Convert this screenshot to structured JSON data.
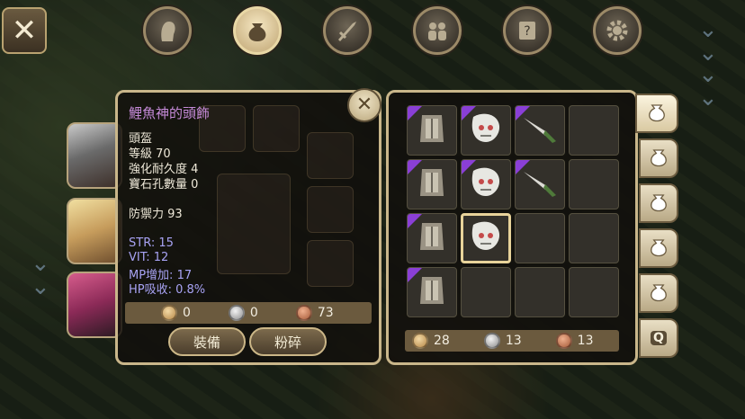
{
  "top_menu": [
    {
      "icon": "profile-icon",
      "active": false
    },
    {
      "icon": "bag-icon",
      "active": true
    },
    {
      "icon": "sword-icon",
      "active": false
    },
    {
      "icon": "party-icon",
      "active": false
    },
    {
      "icon": "quest-scroll-icon",
      "active": false
    },
    {
      "icon": "settings-icon",
      "active": false
    }
  ],
  "item": {
    "name": "鯉魚神的頭飾",
    "type": "頭盔",
    "level": "等級 70",
    "durability": "強化耐久度 4",
    "gem_slots": "寶石孔數量 0",
    "defense": "防禦力 93",
    "stats": [
      "STR: 15",
      "VIT: 12",
      "MP增加: 17",
      "HP吸收: 0.8%"
    ],
    "price": {
      "gold": "0",
      "silver": "0",
      "copper": "73"
    },
    "equip_label": "裝備",
    "crush_label": "粉碎"
  },
  "inventory": {
    "slots": [
      {
        "item": "armor-icon",
        "rare": true
      },
      {
        "item": "mask-icon",
        "rare": true
      },
      {
        "item": "knife-icon",
        "rare": true
      },
      {
        "item": null,
        "rare": false
      },
      {
        "item": "armor-icon",
        "rare": true
      },
      {
        "item": "mask-icon",
        "rare": true
      },
      {
        "item": "knife-icon",
        "rare": true
      },
      {
        "item": null,
        "rare": false
      },
      {
        "item": "armor-icon",
        "rare": true
      },
      {
        "item": "mask-icon",
        "rare": false,
        "selected": true
      },
      {
        "item": null,
        "rare": false
      },
      {
        "item": null,
        "rare": false
      },
      {
        "item": "armor-icon",
        "rare": true
      },
      {
        "item": null,
        "rare": false
      },
      {
        "item": null,
        "rare": false
      },
      {
        "item": null,
        "rare": false
      }
    ],
    "money": {
      "gold": "28",
      "silver": "13",
      "copper": "13"
    },
    "tabs": [
      "bag-tab-1",
      "bag-tab-2",
      "bag-tab-3",
      "bag-tab-4",
      "bag-tab-5",
      "quest-bag-tab"
    ],
    "quest_tab_label": "Q"
  },
  "colors": {
    "rare": "#8a3fd6",
    "frame": "#c9b68a",
    "title": "#c58ad8",
    "stat": "#a8a3f4"
  }
}
